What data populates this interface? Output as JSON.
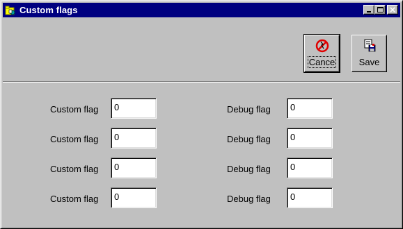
{
  "window": {
    "title": "Custom flags"
  },
  "toolbar": {
    "cancel_label": "Cance",
    "save_label": "Save",
    "cancel_icon": "no-sign-icon",
    "save_icon": "save-document-icon"
  },
  "custom_flags": [
    {
      "label": "Custom flag",
      "value": "0"
    },
    {
      "label": "Custom flag",
      "value": "0"
    },
    {
      "label": "Custom flag",
      "value": "0"
    },
    {
      "label": "Custom flag",
      "value": "0"
    }
  ],
  "debug_flags": [
    {
      "label": "Debug flag",
      "value": "0"
    },
    {
      "label": "Debug flag",
      "value": "0"
    },
    {
      "label": "Debug flag",
      "value": "0"
    },
    {
      "label": "Debug flag",
      "value": "0"
    }
  ],
  "colors": {
    "titlebar": "#000080",
    "face": "#c0c0c0",
    "cancel_red": "#e00000"
  }
}
